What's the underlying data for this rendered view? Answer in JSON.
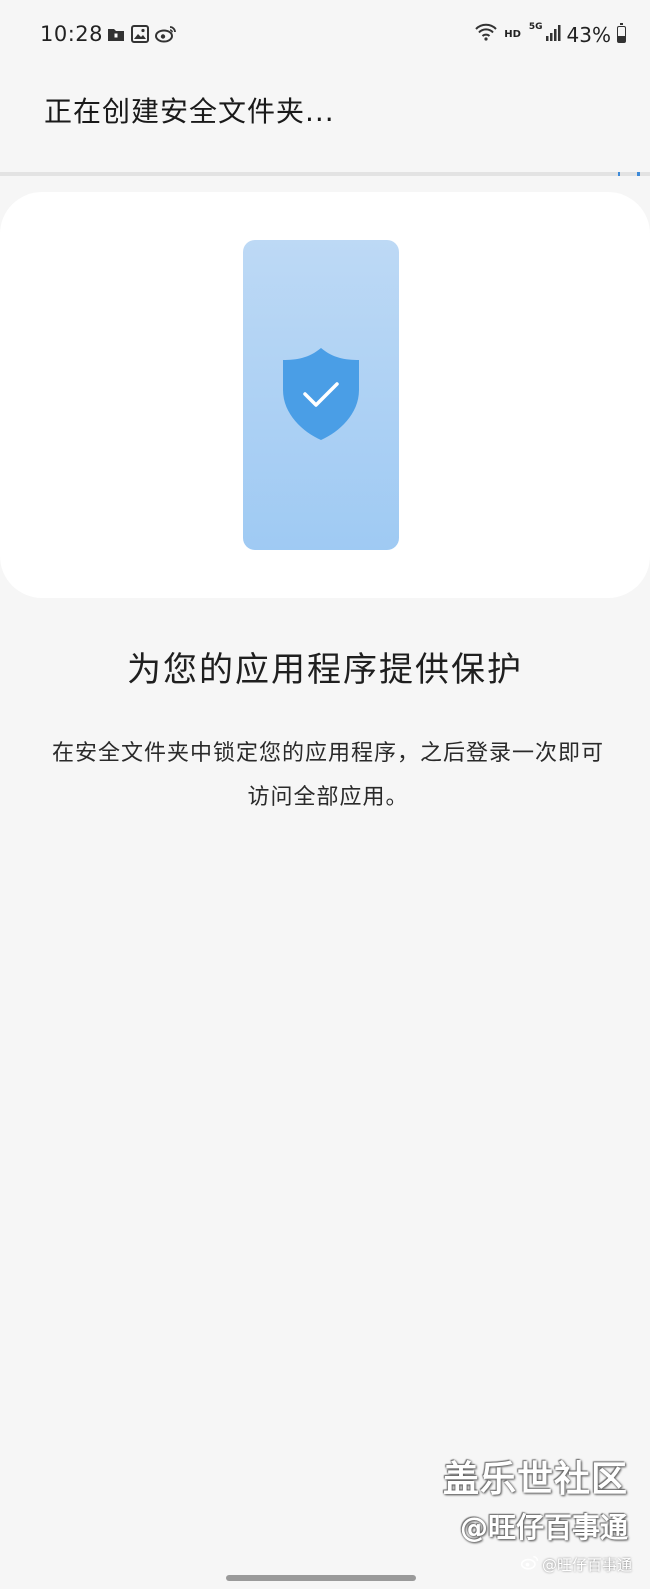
{
  "status_bar": {
    "time": "10:28",
    "left_icons": [
      "folder-lock-icon",
      "image-icon",
      "weibo-icon"
    ],
    "hd_label": "HD",
    "network_label": "5G",
    "battery_percent": "43%",
    "battery_level": 0.43
  },
  "header": {
    "title": "正在创建安全文件夹..."
  },
  "progress": {
    "value": 0.03
  },
  "colors": {
    "background": "#f6f6f6",
    "card": "#ffffff",
    "accent": "#3e8ad8",
    "phone_gradient_top": "#bdd9f5",
    "phone_gradient_bottom": "#9fcaf3",
    "shield": "#4a9ee6"
  },
  "content": {
    "heading": "为您的应用程序提供保护",
    "description": "在安全文件夹中锁定您的应用程序，之后登录一次即可访问全部应用。"
  },
  "watermark": {
    "main": "盖乐世社区",
    "handle": "@旺仔百事通",
    "small": "@旺仔百事通"
  }
}
